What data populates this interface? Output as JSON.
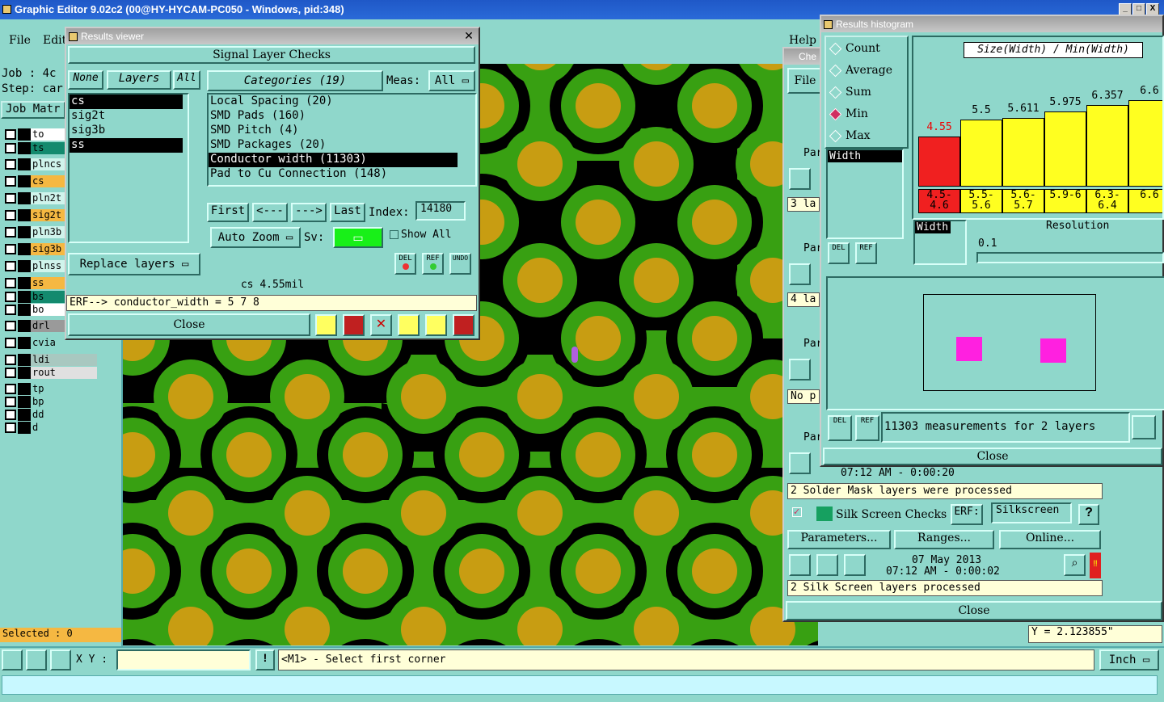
{
  "window": {
    "title": "Graphic Editor 9.02c2 (00@HY-HYCAM-PC050 - Windows, pid:348)",
    "min": "_",
    "max": "□",
    "close": "X"
  },
  "menubar": {
    "file": "File",
    "edit": "Edit",
    "help": "Help"
  },
  "left": {
    "job_label": "Job : 4c",
    "step_label": "Step: car",
    "job_matrix": "Job Matr",
    "layers": [
      {
        "name": "to",
        "color": "#ffffff"
      },
      {
        "name": "ts",
        "color": "#138a6e"
      },
      {
        "name": "plncs",
        "color": "#d0f4ec"
      },
      {
        "name": "cs",
        "color": "#f5b842"
      },
      {
        "name": "pln2t",
        "color": "#d0f4ec"
      },
      {
        "name": "sig2t",
        "color": "#f5b842"
      },
      {
        "name": "pln3b",
        "color": "#d0f4ec"
      },
      {
        "name": "sig3b",
        "color": "#f5b842"
      },
      {
        "name": "plnss",
        "color": "#d0f4ec"
      },
      {
        "name": "ss",
        "color": "#f5b842"
      },
      {
        "name": "bs",
        "color": "#138a6e"
      },
      {
        "name": "bo",
        "color": "#ffffff"
      },
      {
        "name": "drl",
        "color": "#9a9a9a"
      },
      {
        "name": "cvia",
        "color": "#8fd7cb"
      },
      {
        "name": "ldi",
        "color": "#a8c8c0"
      },
      {
        "name": "rout",
        "color": "#e0e0e0"
      },
      {
        "name": "tp",
        "color": "#8fd7cb"
      },
      {
        "name": "bp",
        "color": "#8fd7cb"
      },
      {
        "name": "dd",
        "color": "#8fd7cb"
      },
      {
        "name": "d",
        "color": "#8fd7cb"
      }
    ],
    "selected": "Selected : 0"
  },
  "results_viewer": {
    "title": "Results viewer",
    "header": "Signal Layer Checks",
    "none": "None",
    "layers_btn": "Layers",
    "all": "All",
    "layer_list": [
      "cs",
      "sig2t",
      "sig3b",
      "ss"
    ],
    "categories_btn": "Categories (19)",
    "meas_label": "Meas:",
    "meas_value": "All",
    "categories": [
      "Local Spacing (20)",
      "SMD Pads (160)",
      "SMD Pitch (4)",
      "SMD Packages (20)",
      "Conductor width (11303)",
      "Pad to Cu Connection (148)"
    ],
    "first": "First",
    "prev": "<---",
    "next": "--->",
    "last": "Last",
    "index_label": "Index:",
    "index_value": "14180",
    "auto_zoom": "Auto Zoom",
    "sv_label": "Sv:",
    "show_all": "Show All",
    "replace_layers": "Replace layers",
    "del": "DEL",
    "ref": "REF",
    "undo": "UNDO",
    "status_value": "cs 4.55mil",
    "erf_line": "ERF--> conductor_width = 5 7 8",
    "close": "Close"
  },
  "histogram": {
    "title": "Results histogram",
    "options": [
      "Count",
      "Average",
      "Sum",
      "Min",
      "Max"
    ],
    "selected_option": "Min",
    "field": "Width",
    "chart_title": "Size(Width) / Min(Width)",
    "res_field": "Width",
    "res_label": "Resolution",
    "res_value": "0.1",
    "summary": "11303 measurements for 2 layers",
    "close": "Close",
    "del": "DEL",
    "ref": "REF"
  },
  "chart_data": {
    "type": "bar",
    "title": "Size(Width) / Min(Width)",
    "categories": [
      "4.5-4.6",
      "5.5-5.6",
      "5.6-5.7",
      "5.9-6",
      "6.3-6.4",
      "6.6"
    ],
    "values": [
      4.55,
      5.5,
      5.611,
      5.975,
      6.357,
      6.6
    ],
    "labels": [
      "4.55",
      "5.5",
      "5.611",
      "5.975",
      "6.357",
      "6.6"
    ],
    "colors": [
      "#f02020",
      "#ffff20",
      "#ffff20",
      "#ffff20",
      "#ffff20",
      "#ffff20"
    ],
    "ylim": [
      0,
      7
    ]
  },
  "checks": {
    "title": "Che",
    "file": "File",
    "partial_items": [
      "3 la",
      "4 la",
      "No p"
    ],
    "param_label": "Par",
    "solder_time": "07:12 AM - 0:00:20",
    "solder_status": "2 Solder Mask layers were processed",
    "silk_title": "Silk Screen Checks",
    "erf_label": "ERF:",
    "silk_erf": "Silkscreen",
    "help": "?",
    "parameters": "Parameters...",
    "ranges": "Ranges...",
    "online": "Online...",
    "silk_date": "07 May 2013",
    "silk_time": "07:12 AM - 0:00:02",
    "silk_status": "2 Silk Screen layers processed",
    "close": "Close"
  },
  "coords": {
    "y": "Y = 2.123855\""
  },
  "bottom": {
    "xy_label": "X Y :",
    "xy_value": "",
    "warn": "!",
    "prompt": "<M1> - Select first corner",
    "unit": "Inch"
  }
}
